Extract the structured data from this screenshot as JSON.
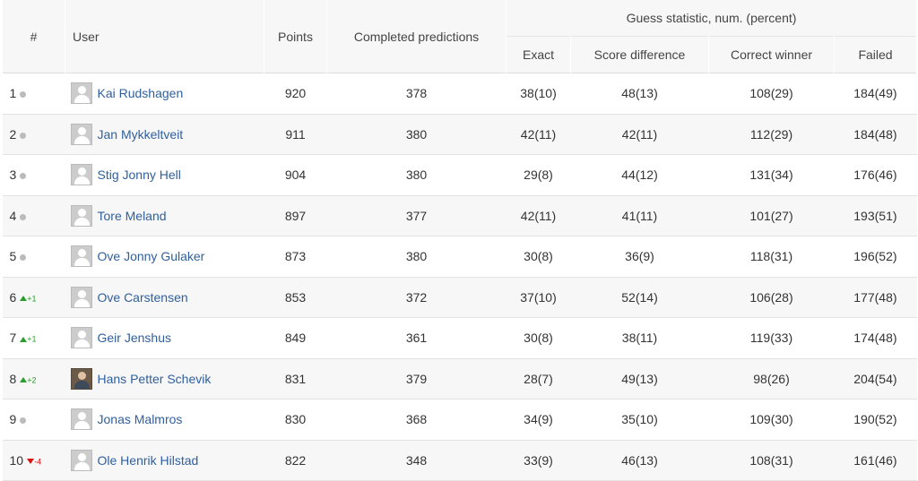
{
  "headers": {
    "rank": "#",
    "user": "User",
    "points": "Points",
    "completed": "Completed predictions",
    "group": "Guess statistic, num. (percent)",
    "exact": "Exact",
    "score_diff": "Score difference",
    "correct_winner": "Correct winner",
    "failed": "Failed"
  },
  "rows": [
    {
      "rank": "1",
      "trend": "same",
      "change": "",
      "name": "Kai Rudshagen",
      "avatar": "default",
      "points": "920",
      "completed": "378",
      "exact": "38(10)",
      "score_diff": "48(13)",
      "correct_winner": "108(29)",
      "failed": "184(49)"
    },
    {
      "rank": "2",
      "trend": "same",
      "change": "",
      "name": "Jan Mykkeltveit",
      "avatar": "default",
      "points": "911",
      "completed": "380",
      "exact": "42(11)",
      "score_diff": "42(11)",
      "correct_winner": "112(29)",
      "failed": "184(48)"
    },
    {
      "rank": "3",
      "trend": "same",
      "change": "",
      "name": "Stig Jonny Hell",
      "avatar": "default",
      "points": "904",
      "completed": "380",
      "exact": "29(8)",
      "score_diff": "44(12)",
      "correct_winner": "131(34)",
      "failed": "176(46)"
    },
    {
      "rank": "4",
      "trend": "same",
      "change": "",
      "name": "Tore Meland",
      "avatar": "default",
      "points": "897",
      "completed": "377",
      "exact": "42(11)",
      "score_diff": "41(11)",
      "correct_winner": "101(27)",
      "failed": "193(51)"
    },
    {
      "rank": "5",
      "trend": "same",
      "change": "",
      "name": "Ove Jonny Gulaker",
      "avatar": "default",
      "points": "873",
      "completed": "380",
      "exact": "30(8)",
      "score_diff": "36(9)",
      "correct_winner": "118(31)",
      "failed": "196(52)"
    },
    {
      "rank": "6",
      "trend": "up",
      "change": "+1",
      "name": "Ove Carstensen",
      "avatar": "default",
      "points": "853",
      "completed": "372",
      "exact": "37(10)",
      "score_diff": "52(14)",
      "correct_winner": "106(28)",
      "failed": "177(48)"
    },
    {
      "rank": "7",
      "trend": "up",
      "change": "+1",
      "name": "Geir Jenshus",
      "avatar": "default",
      "points": "849",
      "completed": "361",
      "exact": "30(8)",
      "score_diff": "38(11)",
      "correct_winner": "119(33)",
      "failed": "174(48)"
    },
    {
      "rank": "8",
      "trend": "up",
      "change": "+2",
      "name": "Hans Petter Schevik",
      "avatar": "photo",
      "points": "831",
      "completed": "379",
      "exact": "28(7)",
      "score_diff": "49(13)",
      "correct_winner": "98(26)",
      "failed": "204(54)"
    },
    {
      "rank": "9",
      "trend": "same",
      "change": "",
      "name": "Jonas Malmros",
      "avatar": "default",
      "points": "830",
      "completed": "368",
      "exact": "34(9)",
      "score_diff": "35(10)",
      "correct_winner": "109(30)",
      "failed": "190(52)"
    },
    {
      "rank": "10",
      "trend": "down",
      "change": "-4",
      "name": "Ole Henrik Hilstad",
      "avatar": "default",
      "points": "822",
      "completed": "348",
      "exact": "33(9)",
      "score_diff": "46(13)",
      "correct_winner": "108(31)",
      "failed": "161(46)"
    }
  ]
}
